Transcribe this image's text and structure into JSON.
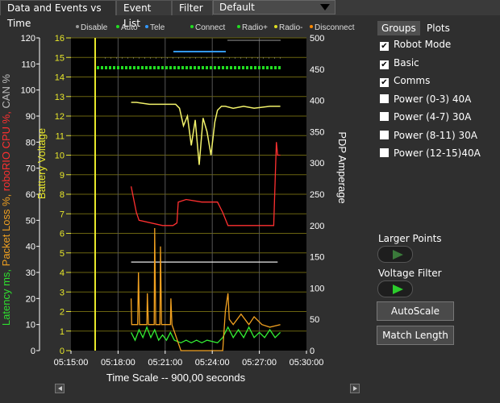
{
  "tabs": [
    "Data and Events vs Time",
    "Event List",
    "Filter"
  ],
  "filter_value": "Default",
  "panel_tabs": [
    "Groups",
    "Plots"
  ],
  "groups": [
    {
      "label": "Robot Mode",
      "checked": true
    },
    {
      "label": "Basic",
      "checked": true
    },
    {
      "label": "Comms",
      "checked": true
    },
    {
      "label": "Power (0-3) 40A",
      "checked": false
    },
    {
      "label": "Power (4-7) 30A",
      "checked": false
    },
    {
      "label": "Power (8-11) 30A",
      "checked": false
    },
    {
      "label": "Power (12-15)40A",
      "checked": false
    }
  ],
  "larger_points_label": "Larger Points",
  "voltage_filter_label": "Voltage Filter",
  "autoscale_label": "AutoScale",
  "match_length_label": "Match Length",
  "chart_data": {
    "type": "line",
    "left_axis_label_parts": [
      {
        "text": "Latency ms,",
        "color": "#2ee02e"
      },
      {
        "text": "Packet Loss %,",
        "color": "#f0a020"
      },
      {
        "text": "roboRIO CPU %,",
        "color": "#ff3030"
      },
      {
        "text": "CAN %",
        "color": "#bbbbbb"
      }
    ],
    "left_ticks": [
      "0",
      "10",
      "20",
      "30",
      "40",
      "50",
      "60",
      "70",
      "80",
      "90",
      "100",
      "110",
      "120"
    ],
    "voltage_axis_label": "Battery Voltage",
    "voltage_ticks": [
      "0",
      "1",
      "2",
      "3",
      "4",
      "5",
      "6",
      "7",
      "8",
      "9",
      "10",
      "11",
      "12",
      "13",
      "14",
      "15",
      "16"
    ],
    "right_axis_label": "PDP Amperage",
    "right_ticks": [
      "0",
      "50",
      "100",
      "150",
      "200",
      "250",
      "300",
      "350",
      "400",
      "450",
      "500"
    ],
    "x_ticks": [
      "05:15:00",
      "05:18:00",
      "05:21:00",
      "05:24:00",
      "05:27:00",
      "05:30:00"
    ],
    "x_label": "Time Scale -- 900,00 seconds",
    "legend": [
      {
        "text": "Disable",
        "color": "#9a9a9a"
      },
      {
        "text": "Auto",
        "color": "#22dd22"
      },
      {
        "text": "Tele",
        "color": "#3399ff"
      },
      {
        "text": "Connect",
        "color": "#22dd22"
      },
      {
        "text": "Radio+",
        "color": "#22dd22"
      },
      {
        "text": "Radio-",
        "color": "#dddd22"
      },
      {
        "text": "Disconnect",
        "color": "#ff8800"
      }
    ],
    "x_range_seconds": [
      0,
      900
    ],
    "voltage_range": [
      0,
      16
    ],
    "series": [
      {
        "name": "Battery Voltage",
        "color": "#f2f26a",
        "points": [
          [
            230,
            12.7
          ],
          [
            250,
            12.7
          ],
          [
            300,
            12.6
          ],
          [
            360,
            12.6
          ],
          [
            400,
            12.6
          ],
          [
            415,
            12.4
          ],
          [
            430,
            11.5
          ],
          [
            445,
            12.0
          ],
          [
            460,
            10.5
          ],
          [
            475,
            11.8
          ],
          [
            490,
            9.5
          ],
          [
            505,
            11.9
          ],
          [
            520,
            11.2
          ],
          [
            535,
            10.0
          ],
          [
            550,
            11.7
          ],
          [
            560,
            12.3
          ],
          [
            575,
            12.5
          ],
          [
            590,
            12.5
          ],
          [
            620,
            12.4
          ],
          [
            660,
            12.5
          ],
          [
            700,
            12.4
          ],
          [
            760,
            12.5
          ],
          [
            800,
            12.5
          ]
        ]
      },
      {
        "name": "roboRIO CPU %",
        "color": "#ff3030",
        "points": [
          [
            230,
            63
          ],
          [
            250,
            53
          ],
          [
            260,
            50
          ],
          [
            350,
            48
          ],
          [
            390,
            48
          ],
          [
            405,
            49
          ],
          [
            410,
            57
          ],
          [
            440,
            58
          ],
          [
            500,
            57
          ],
          [
            560,
            57
          ],
          [
            580,
            53
          ],
          [
            600,
            48
          ],
          [
            650,
            48
          ],
          [
            700,
            48
          ],
          [
            775,
            48
          ],
          [
            785,
            80
          ],
          [
            790,
            75
          ],
          [
            800,
            75
          ]
        ]
      },
      {
        "name": "CAN %",
        "color": "#e8e8e8",
        "points": [
          [
            230,
            34
          ],
          [
            300,
            34
          ],
          [
            400,
            34
          ],
          [
            500,
            34
          ],
          [
            600,
            34
          ],
          [
            700,
            34
          ],
          [
            790,
            34
          ]
        ]
      },
      {
        "name": "Latency ms",
        "color": "#33ee33",
        "points": [
          [
            230,
            7
          ],
          [
            245,
            4
          ],
          [
            260,
            8
          ],
          [
            275,
            5
          ],
          [
            290,
            9
          ],
          [
            305,
            5
          ],
          [
            320,
            8
          ],
          [
            335,
            4
          ],
          [
            350,
            6
          ],
          [
            365,
            4
          ],
          [
            380,
            7
          ],
          [
            395,
            4
          ],
          [
            420,
            3
          ],
          [
            440,
            4
          ],
          [
            460,
            3
          ],
          [
            480,
            4
          ],
          [
            500,
            3
          ],
          [
            520,
            4
          ],
          [
            560,
            3
          ],
          [
            580,
            5
          ],
          [
            600,
            9
          ],
          [
            620,
            5
          ],
          [
            640,
            8
          ],
          [
            660,
            5
          ],
          [
            680,
            9
          ],
          [
            700,
            5
          ],
          [
            720,
            7
          ],
          [
            740,
            5
          ],
          [
            760,
            8
          ],
          [
            780,
            5
          ],
          [
            800,
            7
          ]
        ]
      },
      {
        "name": "Packet Loss %",
        "color": "#f0a020",
        "points": [
          [
            230,
            20
          ],
          [
            232,
            10
          ],
          [
            255,
            10
          ],
          [
            258,
            30
          ],
          [
            262,
            10
          ],
          [
            290,
            10
          ],
          [
            292,
            22
          ],
          [
            296,
            10
          ],
          [
            318,
            10
          ],
          [
            320,
            47
          ],
          [
            324,
            10
          ],
          [
            340,
            10
          ],
          [
            342,
            40
          ],
          [
            346,
            10
          ],
          [
            380,
            10
          ],
          [
            382,
            20
          ],
          [
            386,
            10
          ],
          [
            420,
            0
          ],
          [
            580,
            0
          ],
          [
            590,
            15
          ],
          [
            600,
            22
          ],
          [
            605,
            12
          ],
          [
            620,
            10
          ],
          [
            650,
            14
          ],
          [
            680,
            10
          ],
          [
            700,
            13
          ],
          [
            730,
            10
          ],
          [
            760,
            9
          ],
          [
            800,
            10
          ]
        ]
      }
    ]
  }
}
